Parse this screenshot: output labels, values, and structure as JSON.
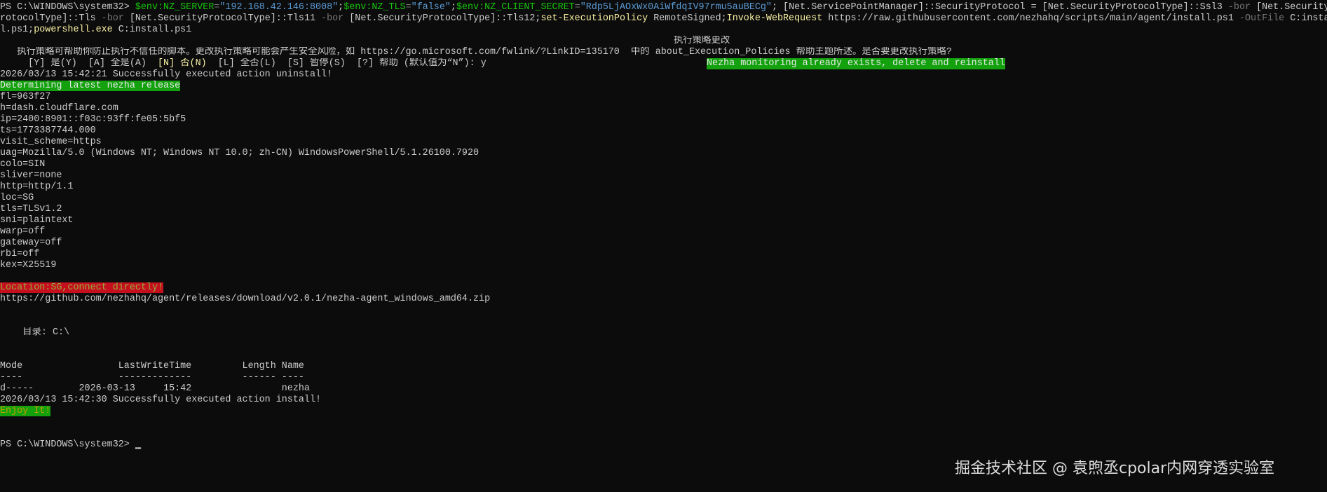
{
  "terminal": {
    "lines": [
      [
        {
          "t": "PS C:\\WINDOWS\\system32> ",
          "c": ""
        },
        {
          "t": "$env:NZ_SERVER",
          "c": "s-var"
        },
        {
          "t": "=",
          "c": "s-op"
        },
        {
          "t": "\"192.168.42.146:8008\"",
          "c": "s-str"
        },
        {
          "t": ";",
          "c": ""
        },
        {
          "t": "$env:NZ_TLS",
          "c": "s-var"
        },
        {
          "t": "=",
          "c": "s-op"
        },
        {
          "t": "\"false\"",
          "c": "s-str"
        },
        {
          "t": ";",
          "c": ""
        },
        {
          "t": "$env:NZ_CLIENT_SECRET",
          "c": "s-var"
        },
        {
          "t": "=",
          "c": "s-op"
        },
        {
          "t": "\"Rdp5LjAOxWx0AiWfdqIV97rmu5auBECg\"",
          "c": "s-str"
        },
        {
          "t": "; [Net.ServicePointManager]::SecurityProtocol = [Net.SecurityProtocolType]::Ssl3 ",
          "c": ""
        },
        {
          "t": "-bor",
          "c": "s-op"
        },
        {
          "t": " [Net.SecurityP",
          "c": ""
        }
      ],
      [
        {
          "t": "rotocolType]::Tls ",
          "c": ""
        },
        {
          "t": "-bor",
          "c": "s-op"
        },
        {
          "t": " [Net.SecurityProtocolType]::Tls11 ",
          "c": ""
        },
        {
          "t": "-bor",
          "c": "s-op"
        },
        {
          "t": " [Net.SecurityProtocolType]::Tls12;",
          "c": ""
        },
        {
          "t": "set-ExecutionPolicy",
          "c": "s-cmd"
        },
        {
          "t": " RemoteSigned;",
          "c": ""
        },
        {
          "t": "Invoke-WebRequest",
          "c": "s-cmd"
        },
        {
          "t": " https://raw.githubusercontent.com/nezhahq/scripts/main/agent/install.ps1 ",
          "c": ""
        },
        {
          "t": "-OutFile",
          "c": "s-op"
        },
        {
          "t": " C:instal",
          "c": ""
        }
      ],
      [
        {
          "t": "l.ps1;",
          "c": ""
        },
        {
          "t": "powershell.exe",
          "c": "s-cmd"
        },
        {
          "t": " C:install.ps1",
          "c": ""
        }
      ],
      [
        {
          "t": "执行策略更改",
          "c": "pos-title"
        }
      ],
      [
        {
          "t": "   执行策略可帮助你防止执行不信任的脚本。更改执行策略可能会产生安全风险，如 https://go.microsoft.com/fwlink/?LinkID=135170  中的 about_Execution_Policies 帮助主题所述。是否要更改执行策略?",
          "c": ""
        }
      ],
      [
        {
          "t": "     [Y] 是(Y)  [A] 全是(A)  ",
          "c": ""
        },
        {
          "t": "[N] 否(N)",
          "c": "s-yel"
        },
        {
          "t": "  [L] 全否(L)  [S] 暂停(S)  [?] 帮助 (默认值为“N”): y",
          "c": ""
        },
        {
          "t": "Nezha monitoring already exists, delete and reinstall",
          "c": "s-greenbg pos-note"
        }
      ],
      [
        {
          "t": "2026/03/13 15:42:21 Successfully executed action uninstall!",
          "c": ""
        }
      ],
      [
        {
          "t": "Determining latest nezha release",
          "c": "s-greenbg"
        }
      ],
      [
        {
          "t": "fl=963f27",
          "c": ""
        }
      ],
      [
        {
          "t": "h=dash.cloudflare.com",
          "c": ""
        }
      ],
      [
        {
          "t": "ip=2400:8901::f03c:93ff:fe05:5bf5",
          "c": ""
        }
      ],
      [
        {
          "t": "ts=1773387744.000",
          "c": ""
        }
      ],
      [
        {
          "t": "visit_scheme=https",
          "c": ""
        }
      ],
      [
        {
          "t": "uag=Mozilla/5.0 (Windows NT; Windows NT 10.0; zh-CN) WindowsPowerShell/5.1.26100.7920",
          "c": ""
        }
      ],
      [
        {
          "t": "colo=SIN",
          "c": ""
        }
      ],
      [
        {
          "t": "sliver=none",
          "c": ""
        }
      ],
      [
        {
          "t": "http=http/1.1",
          "c": ""
        }
      ],
      [
        {
          "t": "loc=SG",
          "c": ""
        }
      ],
      [
        {
          "t": "tls=TLSv1.2",
          "c": ""
        }
      ],
      [
        {
          "t": "sni=plaintext",
          "c": ""
        }
      ],
      [
        {
          "t": "warp=off",
          "c": ""
        }
      ],
      [
        {
          "t": "gateway=off",
          "c": ""
        }
      ],
      [
        {
          "t": "rbi=off",
          "c": ""
        }
      ],
      [
        {
          "t": "kex=X25519",
          "c": ""
        }
      ],
      [],
      [
        {
          "t": "Location:SG,connect directly!",
          "c": "s-redbg"
        }
      ],
      [
        {
          "t": "https://github.com/nezhahq/agent/releases/download/v2.0.1/nezha-agent_windows_amd64.zip",
          "c": ""
        }
      ],
      [],
      [],
      [
        {
          "t": "    目录: C:\\",
          "c": ""
        }
      ],
      [],
      [],
      [
        {
          "t": "Mode                 LastWriteTime         Length Name",
          "c": ""
        }
      ],
      [
        {
          "t": "----                 -------------         ------ ----",
          "c": ""
        }
      ],
      [
        {
          "t": "d-----        2026-03-13     15:42                nezha",
          "c": ""
        }
      ],
      [
        {
          "t": "2026/03/13 15:42:30 Successfully executed action install!",
          "c": ""
        }
      ],
      [
        {
          "t": "Enjoy It!",
          "c": "s-enjoy"
        }
      ],
      [],
      [],
      [
        {
          "t": "PS C:\\WINDOWS\\system32> ",
          "c": ""
        },
        {
          "t": "▁",
          "c": "s-cursor"
        }
      ]
    ]
  },
  "watermark": "掘金技术社区 @ 袁煦丞cpolar内网穿透实验室",
  "colors": {
    "background": "#0c0c0c",
    "foreground": "#cccccc",
    "variable": "#16c60c",
    "string": "#5b9bd5",
    "command": "#f9f1a5",
    "green_bg": "#13a10e",
    "red_bg": "#c50f1f"
  }
}
